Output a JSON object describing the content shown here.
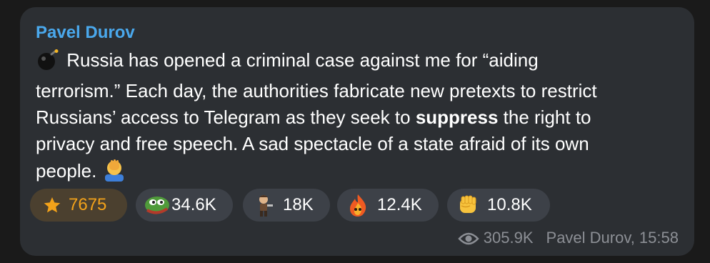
{
  "message": {
    "author": "Pavel Durov",
    "lines": [
      "Russia has opened a criminal case against me for “aiding",
      "terrorism.” Each day, the authorities fabricate new pretexts to restrict",
      "Russians’ access to Telegram as they seek to ",
      "suppress",
      " the right to",
      "privacy and free speech. A sad spectacle of a state afraid of its own",
      "people."
    ],
    "leading_icon": "bomb-emoji-icon",
    "trailing_icon": "facepalm-emoji-icon"
  },
  "reactions": [
    {
      "icon": "star-icon",
      "count": "7675"
    },
    {
      "icon": "pepe-frog-sticker-icon",
      "count": "34.6K"
    },
    {
      "icon": "pirate-character-sticker-icon",
      "count": "18K"
    },
    {
      "icon": "fire-character-sticker-icon",
      "count": "12.4K"
    },
    {
      "icon": "raised-fist-emoji-icon",
      "count": "10.8K"
    }
  ],
  "footer": {
    "views": "305.9K",
    "signature": "Pavel Durov, 15:58"
  },
  "colors": {
    "author": "#4aa8ec",
    "bubble": "#2c2f33",
    "star_count": "#f3a21a",
    "meta": "#8c8f95"
  }
}
